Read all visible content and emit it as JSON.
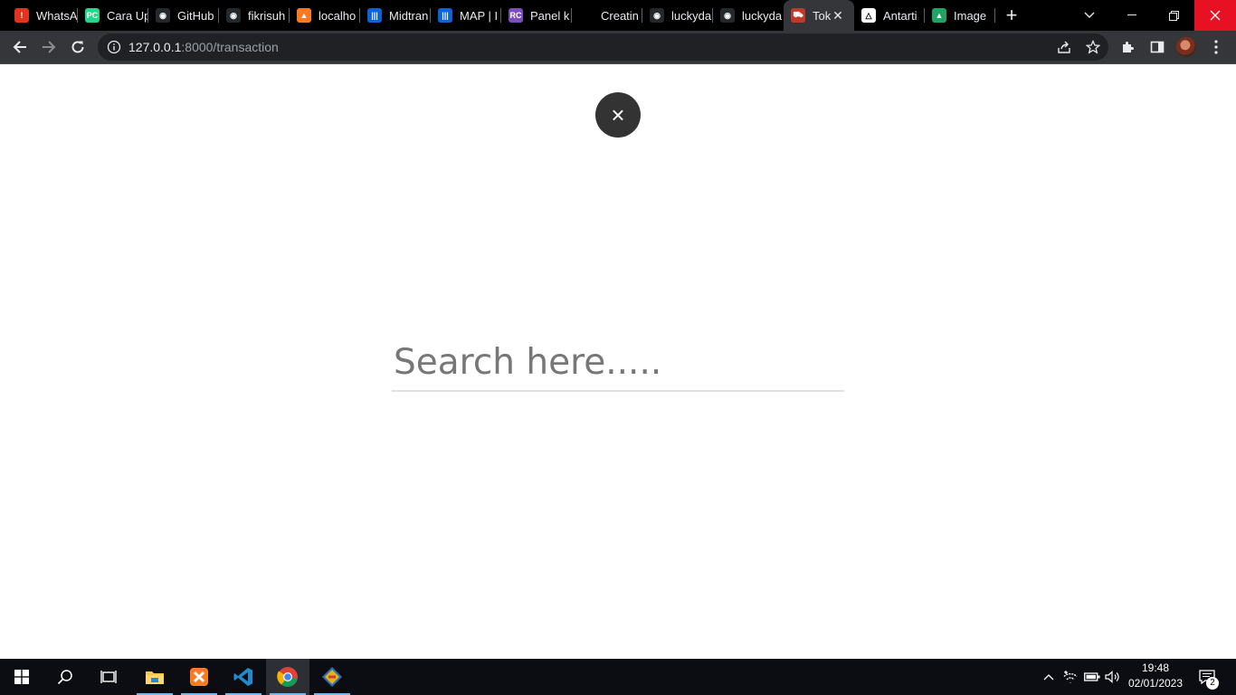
{
  "browser": {
    "tabs": [
      {
        "title": "WhatsA",
        "icon": "whatsapp-icon",
        "color": "#e0341e",
        "glyph": "!"
      },
      {
        "title": "Cara Up",
        "icon": "pycharm-icon",
        "color": "#21d789",
        "glyph": "PC"
      },
      {
        "title": "GitHub",
        "icon": "github-icon",
        "color": "#24292e",
        "glyph": "◉"
      },
      {
        "title": "fikrisuh",
        "icon": "github-icon",
        "color": "#24292e",
        "glyph": "◉"
      },
      {
        "title": "localho",
        "icon": "xampp-icon",
        "color": "#fb7a24",
        "glyph": "▲"
      },
      {
        "title": "Midtran",
        "icon": "midtrans-icon",
        "color": "#0b63d8",
        "glyph": "|||"
      },
      {
        "title": "MAP | I",
        "icon": "midtrans-icon",
        "color": "#0b63d8",
        "glyph": "|||"
      },
      {
        "title": "Panel k",
        "icon": "rc-icon",
        "color": "#7c4dbb",
        "glyph": "RC"
      },
      {
        "title": "Creatin",
        "icon": "blank-page-icon",
        "color": "#000000",
        "glyph": ""
      },
      {
        "title": "luckyda",
        "icon": "github-icon",
        "color": "#24292e",
        "glyph": "◉"
      },
      {
        "title": "luckyda",
        "icon": "github-icon",
        "color": "#24292e",
        "glyph": "◉"
      },
      {
        "title": "Tok",
        "icon": "store-icon",
        "color": "#c0392b",
        "glyph": "⛟"
      },
      {
        "title": "Antarti",
        "icon": "antarti-icon",
        "color": "#ffffff",
        "glyph": "△"
      },
      {
        "title": "Image",
        "icon": "google-drive-icon",
        "color": "#1fa463",
        "glyph": "▲"
      }
    ],
    "url_host": "127.0.0.1",
    "url_path": ":8000/transaction"
  },
  "page": {
    "close_symbol": "×",
    "search_placeholder": "Search here....."
  },
  "taskbar": {
    "time": "19:48",
    "date": "02/01/2023",
    "notification_count": "2"
  }
}
